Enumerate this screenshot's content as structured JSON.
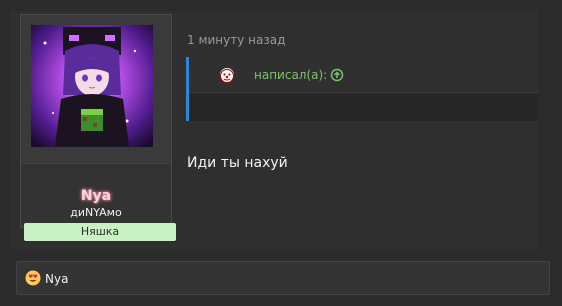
{
  "post": {
    "timestamp": "1 минуту назад",
    "message": "Иди ты нахуй",
    "quote": {
      "author_label": "написал(а):",
      "author_color": "#7cc36a",
      "accent_color": "#2d86d8",
      "avatar_icon": "clown-icon",
      "jump_icon": "arrow-up-circle-icon"
    }
  },
  "user": {
    "name": "Nya",
    "title": "диNYAмо",
    "banner": "Няшка",
    "banner_color": "#c9f2c4"
  },
  "reactions": {
    "icon": "heart-eyes-emoji-icon",
    "user": "Nya"
  }
}
